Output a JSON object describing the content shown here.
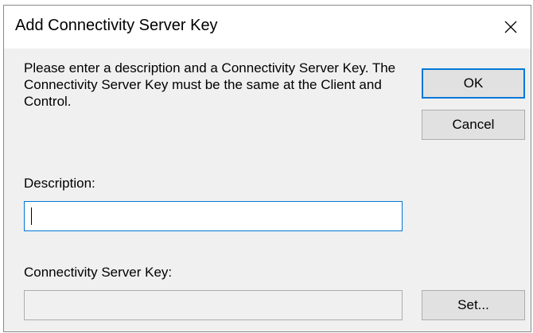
{
  "dialog": {
    "title": "Add Connectivity Server Key",
    "close_icon": "close-icon",
    "instructions": "Please enter a description and a Connectivity Server Key. The Connectivity Server Key must be the same at the Client and Control.",
    "ok_label": "OK",
    "cancel_label": "Cancel",
    "description": {
      "label": "Description:",
      "value": ""
    },
    "server_key": {
      "label": "Connectivity Server Key:",
      "value": ""
    },
    "set_label": "Set..."
  },
  "colors": {
    "accent": "#0078d7",
    "dialog_background": "#f0f0f0",
    "button_background": "#e1e1e1"
  }
}
